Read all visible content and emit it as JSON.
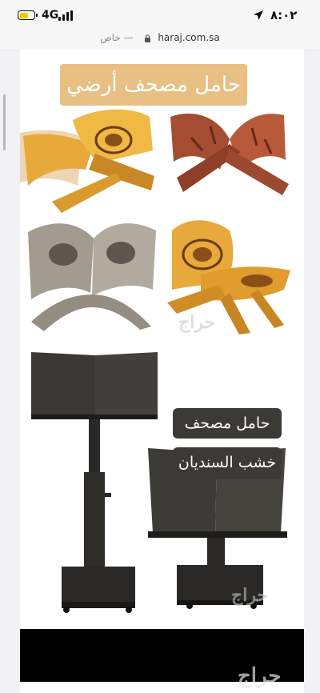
{
  "status_bar": {
    "network": "4G",
    "time": "٨:٠٢",
    "battery_level": 0.6
  },
  "url_bar": {
    "private_label": "خاص —",
    "domain": "haraj.com.sa"
  },
  "panels": [
    {
      "banner": "حامل مصحف أرضي",
      "watermark": "حراج"
    },
    {
      "labels": [
        "حامل مصحف",
        "خشب السنديان"
      ],
      "watermark": "حراج"
    },
    {
      "watermark": "حراج"
    }
  ],
  "colors": {
    "banner": "#e8c083",
    "label_box": "#3c3a37",
    "light_wood": "#e7a93a",
    "dark_wood": "#a44d32",
    "grey_wood": "#a39a90",
    "stand": "#2a2927"
  }
}
